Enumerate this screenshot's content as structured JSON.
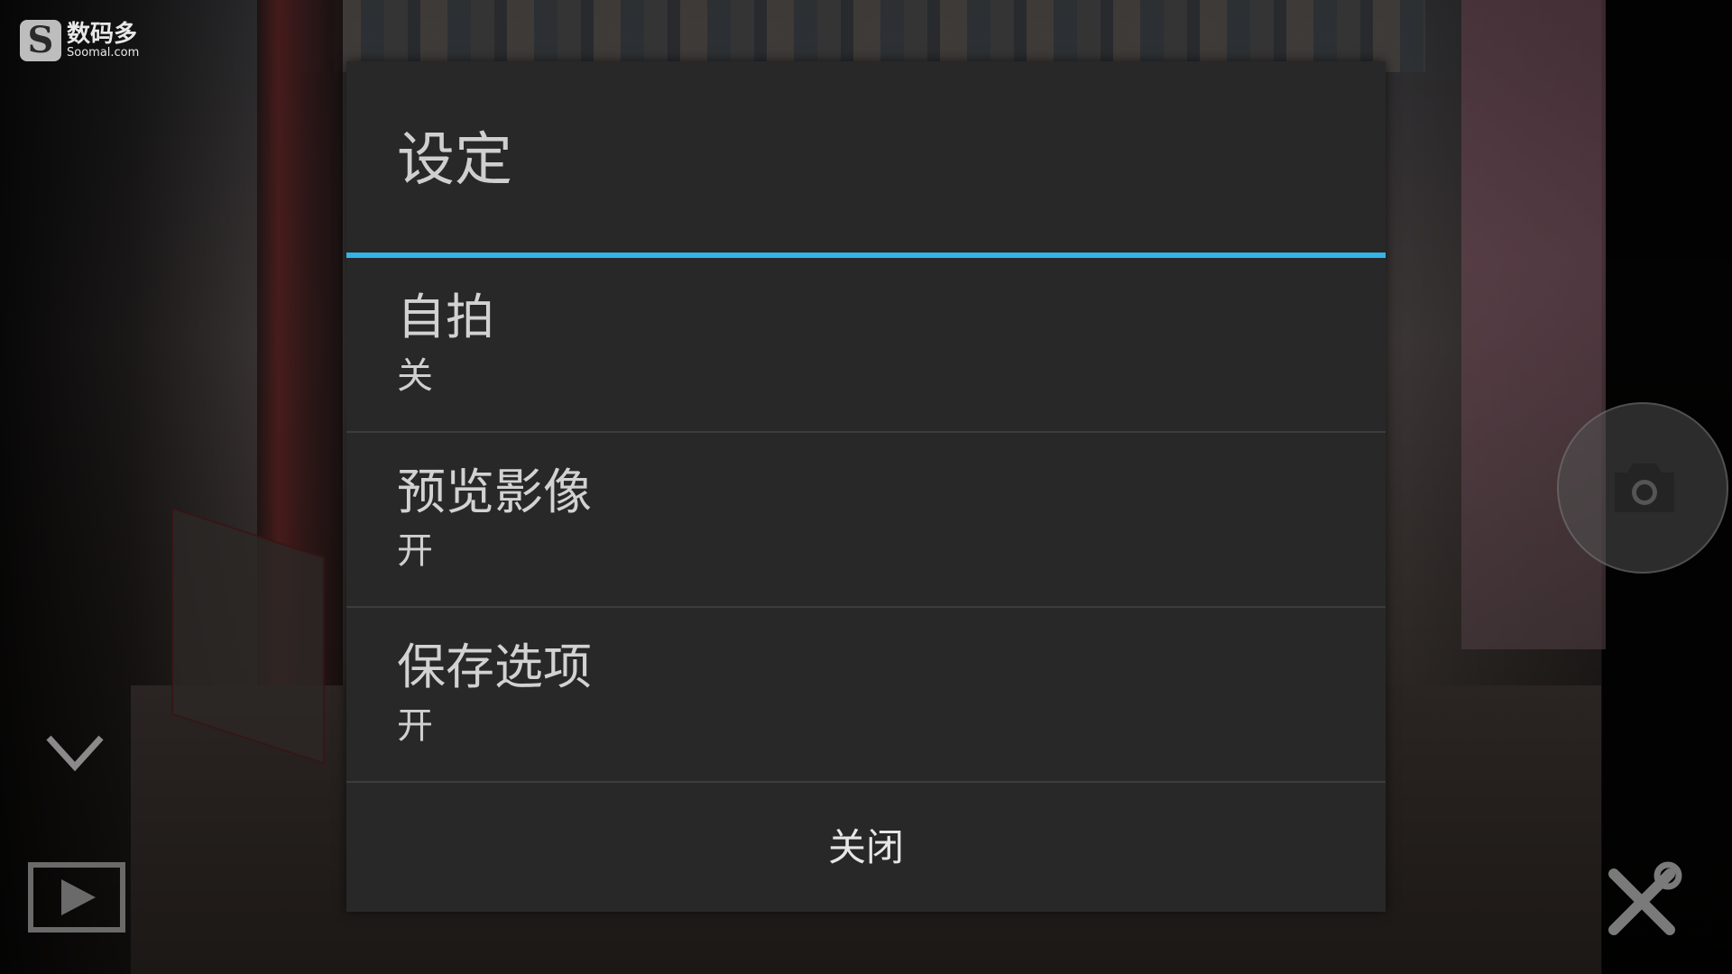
{
  "watermark": {
    "brand_cn": "数码多",
    "brand_en": "Soomal.com",
    "mark": "S"
  },
  "dialog": {
    "title": "设定",
    "accent_color": "#33b5e5",
    "settings": [
      {
        "label": "自拍",
        "value": "关"
      },
      {
        "label": "预览影像",
        "value": "开"
      },
      {
        "label": "保存选项",
        "value": "开"
      }
    ],
    "close_label": "关闭"
  },
  "controls": {
    "left": [
      "chevron-down-icon",
      "play-icon"
    ],
    "right": [
      "camera-icon",
      "tools-icon"
    ]
  }
}
